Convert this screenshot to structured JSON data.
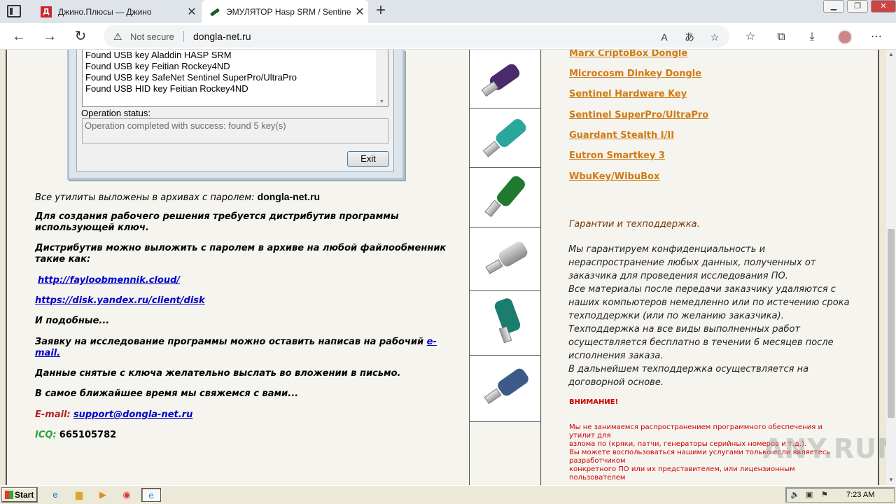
{
  "browser": {
    "tabs": [
      {
        "title": "Джино.Плюсы — Джино",
        "favicon": "Д"
      },
      {
        "title": "ЭМУЛЯТОР Hasp SRM / Sentinel",
        "active": true
      }
    ],
    "address": {
      "security": "Not secure",
      "url": "dongla-net.ru"
    }
  },
  "dialog": {
    "list": [
      "Found USB key Aladdin  HASP SRM",
      "Found USB key Feitian  Rockey4ND",
      "Found USB key SafeNet  Sentinel SuperPro/UltraPro",
      "Found USB HID key Feitian  Rockey4ND"
    ],
    "op_label": "Operation status:",
    "op_status": "Operation completed with success: found 5 key(s)",
    "exit": "Exit"
  },
  "left": {
    "p_archive": "Все утилиты выложены в архивах с паролем:",
    "p_archive_pwd": "dongla-net.ru",
    "p_distrib": "Для создания рабочего решения требуется дистрибутив программы использующей ключ.",
    "p_share": "Дистрибутив можно выложить с паролем в архиве на любой файлообменник такие как:",
    "link1": "http://fayloobmennik.cloud/",
    "link2": "https://disk.yandex.ru/client/disk",
    "p_similar": "И подобные...",
    "p_request": "Заявку на исследование программы можно оставить написав на рабочий",
    "p_request_link": "e-mail.",
    "p_attach": "Данные снятые с ключа желательно выслать во вложении в письмо.",
    "p_contact": "В самое ближайшее время мы свяжемся с вами...",
    "email_label": "E-mail:",
    "email": "support@dongla-net.ru",
    "icq_label": "ICQ:",
    "icq": "665105782"
  },
  "right": {
    "links": [
      "Marx CriptoBox Dongle",
      "Microcosm Dinkey Dongle",
      "Sentinel Hardware Key",
      "Sentinel SuperPro/UltraPro",
      "Guardant Stealth I/II",
      "Eutron Smartkey 3",
      "WbuKey/WibuBox"
    ],
    "guarantee_title": "Гарантии и техподдержка.",
    "guarantee_lines": [
      "Мы гарантируем конфиденциальность и",
      "нераспространение любых данных, полученных от",
      "заказчика для проведения исследования ПО.",
      "Все материалы после передачи заказчику удаляются с",
      "наших компьютеров немедленно или по истечению срока",
      "техподдержки (или по желанию заказчика).",
      "Техподдержка на все виды выполненных работ",
      "осуществляется бесплатно в течении 6 месяцев после",
      "исполнения заказа.",
      "В дальнейшем техподдержка осуществляется на",
      "договорной основе."
    ],
    "warning_title": "ВНИМАНИЕ!",
    "warning_lines": [
      "Мы не занимаемся распространением программного обеспечения и",
      "утилит для",
      "взлома по (кряки, патчи, генераторы серийных номеров и т.д.).",
      "Вы можете воспользоваться нашими услугами только если являетесь",
      "разработчиком",
      "конкретного ПО или их представителем, или лицензионным",
      "пользователем"
    ]
  },
  "watermark": "ANY.RUN",
  "taskbar": {
    "start": "Start",
    "clock": "7:23 AM"
  },
  "colors": {
    "link_orange": "#d07a12",
    "warning_red": "#cc0000",
    "link_blue": "#0000cc"
  }
}
